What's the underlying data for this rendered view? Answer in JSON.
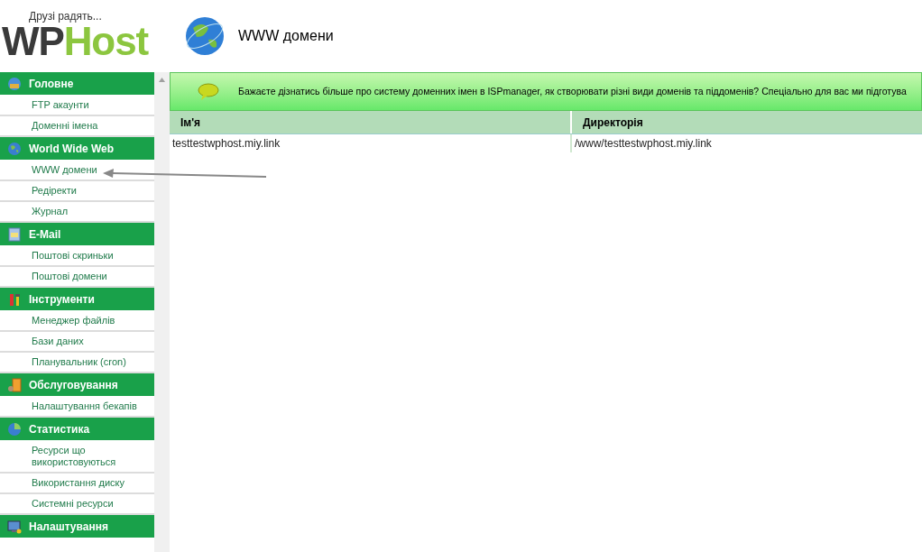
{
  "logo": {
    "tagline": "Друзі радять...",
    "wordmark_dark": "WP",
    "wordmark_green": "Host"
  },
  "page_title": "WWW домени",
  "sidebar": {
    "groups": [
      {
        "label": "Головне",
        "kind": "home",
        "items": [
          {
            "label": "FTP акаунти"
          },
          {
            "label": "Доменні імена"
          }
        ]
      },
      {
        "label": "World Wide Web",
        "kind": "globe",
        "items": [
          {
            "label": "WWW домени"
          },
          {
            "label": "Редіректи"
          },
          {
            "label": "Журнал"
          }
        ]
      },
      {
        "label": "E-Mail",
        "kind": "mail",
        "items": [
          {
            "label": "Поштові скриньки"
          },
          {
            "label": "Поштові домени"
          }
        ]
      },
      {
        "label": "Інструменти",
        "kind": "tools",
        "items": [
          {
            "label": "Менеджер файлів"
          },
          {
            "label": "Бази даних"
          },
          {
            "label": "Планувальник (cron)"
          }
        ]
      },
      {
        "label": "Обслуговування",
        "kind": "boxes",
        "items": [
          {
            "label": "Налаштування бекапів"
          }
        ]
      },
      {
        "label": "Статистика",
        "kind": "pie",
        "items": [
          {
            "label": "Ресурси що використовуються"
          },
          {
            "label": "Використання диску"
          },
          {
            "label": "Системні ресурси"
          }
        ]
      },
      {
        "label": "Налаштування",
        "kind": "monitor"
      }
    ]
  },
  "banner": {
    "text": "Бажаєте дізнатись більше про систему доменних імен в ISPmanager, як створювати різні види доменів та піддоменів? Спеціально для вас ми підготува"
  },
  "table": {
    "columns": [
      "Ім'я",
      "Директорія"
    ],
    "rows": [
      [
        "testtestwphost.miy.link",
        "/www/testtestwphost.miy.link"
      ]
    ]
  }
}
